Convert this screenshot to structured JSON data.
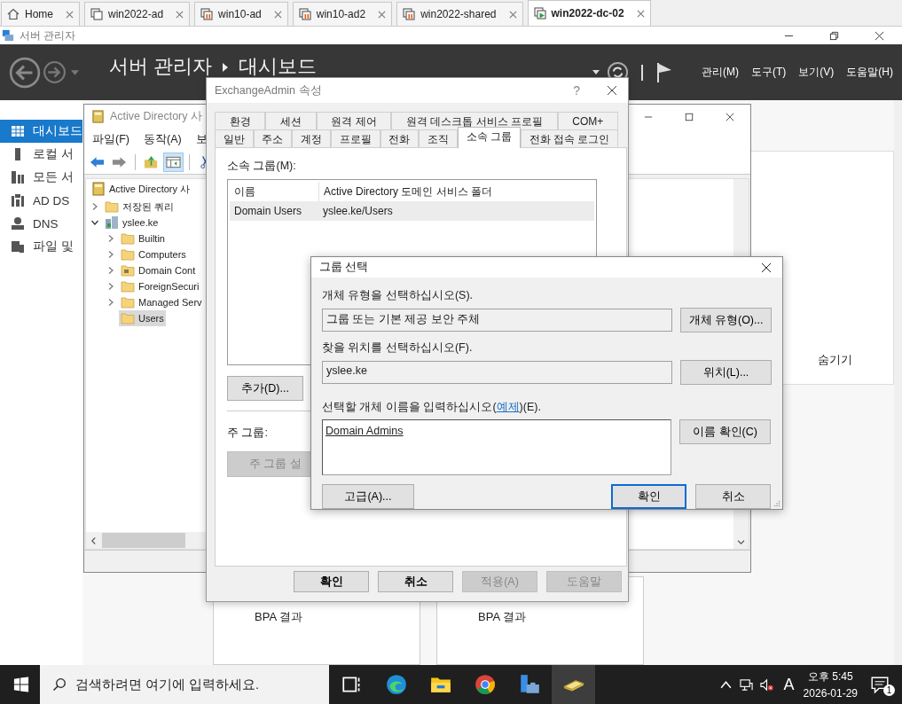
{
  "browser_tabs": [
    {
      "label": "Home",
      "kind": "home",
      "selected": false
    },
    {
      "label": "win2022-ad",
      "kind": "off",
      "selected": false
    },
    {
      "label": "win10-ad",
      "kind": "paused",
      "selected": false
    },
    {
      "label": "win10-ad2",
      "kind": "paused",
      "selected": false
    },
    {
      "label": "win2022-shared",
      "kind": "paused",
      "selected": false
    },
    {
      "label": "win2022-dc-02",
      "kind": "running",
      "selected": true
    }
  ],
  "server_manager": {
    "title": "서버 관리자",
    "breadcrumb": [
      "서버 관리자",
      "대시보드"
    ],
    "menu": [
      "관리(M)",
      "도구(T)",
      "보기(V)",
      "도움말(H)"
    ],
    "nav": [
      {
        "label": "대시보드",
        "kind": "dashboard",
        "selected": true
      },
      {
        "label": "로컬 서",
        "kind": "server",
        "selected": false
      },
      {
        "label": "모든 서",
        "kind": "servers",
        "selected": false
      },
      {
        "label": "AD DS",
        "kind": "adds",
        "selected": false
      },
      {
        "label": "DNS",
        "kind": "dns",
        "selected": false
      },
      {
        "label": "파일 및",
        "kind": "files",
        "selected": false
      }
    ],
    "side_tile": {
      "hide_link": "숨기기"
    },
    "tiles": [
      {
        "items": [
          "BPA 결과"
        ]
      },
      {
        "items": [
          "BPA 결과"
        ]
      }
    ]
  },
  "ad_window": {
    "title": "Active Directory 사",
    "menu": [
      "파일(F)",
      "동작(A)",
      "보"
    ],
    "tree_root": "Active Directory 사",
    "tree": [
      {
        "label": "저장된 쿼리",
        "kind": "folder",
        "expandable": true,
        "expanded": false,
        "selected": false
      },
      {
        "label": "yslee.ke",
        "kind": "domain",
        "expandable": true,
        "expanded": true,
        "selected": false,
        "children": [
          {
            "label": "Builtin",
            "kind": "folder",
            "expandable": true,
            "expanded": false,
            "selected": false
          },
          {
            "label": "Computers",
            "kind": "folder",
            "expandable": true,
            "expanded": false,
            "selected": false
          },
          {
            "label": "Domain Cont",
            "kind": "ou",
            "expandable": true,
            "expanded": false,
            "selected": false
          },
          {
            "label": "ForeignSecuri",
            "kind": "folder",
            "expandable": true,
            "expanded": false,
            "selected": false
          },
          {
            "label": "Managed Serv",
            "kind": "folder",
            "expandable": true,
            "expanded": false,
            "selected": false
          },
          {
            "label": "Users",
            "kind": "folder",
            "expandable": false,
            "selected": true
          }
        ]
      }
    ]
  },
  "properties": {
    "title": "ExchangeAdmin 속성",
    "help_glyph": "?",
    "tab_rows": [
      {
        "tabs": [
          {
            "label": "환경",
            "selected": false
          },
          {
            "label": "세션",
            "selected": false
          },
          {
            "label": "원격 제어",
            "selected": false
          },
          {
            "label": "원격 데스크톱 서비스 프로필",
            "selected": false
          },
          {
            "label": "COM+",
            "selected": false
          }
        ]
      },
      {
        "tabs": [
          {
            "label": "일반",
            "selected": false
          },
          {
            "label": "주소",
            "selected": false
          },
          {
            "label": "계정",
            "selected": false
          },
          {
            "label": "프로필",
            "selected": false
          },
          {
            "label": "전화",
            "selected": false
          },
          {
            "label": "조직",
            "selected": false
          },
          {
            "label": "소속 그룹",
            "selected": true
          },
          {
            "label": "전화 접속 로그인",
            "selected": false
          }
        ]
      }
    ],
    "member_of_label": "소속 그룹(M):",
    "columns": [
      "이름",
      "Active Directory 도메인 서비스 폴더"
    ],
    "rows": [
      {
        "cells": [
          "Domain Users",
          "yslee.ke/Users"
        ],
        "selected": true
      }
    ],
    "add_button": "추가(D)...",
    "primary_group_label": "주 그룹:",
    "set_primary": {
      "label": "주 그룹 설",
      "disabled": true
    },
    "buttons": [
      {
        "label": "확인",
        "disabled": false
      },
      {
        "label": "취소",
        "disabled": false
      },
      {
        "label": "적용(A)",
        "disabled": true
      },
      {
        "label": "도움말",
        "disabled": true
      }
    ]
  },
  "select_group": {
    "title": "그룹 선택",
    "object_type_label": "개체 유형을 선택하십시오(S).",
    "object_type": "그룹 또는 기본 제공 보안 주체",
    "object_type_button": "개체 유형(O)...",
    "location_label": "찾을 위치를 선택하십시오(F).",
    "location": "yslee.ke",
    "location_button": "위치(L)...",
    "names_label": {
      "before": "선택할 개체 이름을 입력하십시오(",
      "link": "예제",
      "after": ")(E)."
    },
    "names": "Domain Admins",
    "check_button": "이름 확인(C)",
    "advanced_button": "고급(A)...",
    "buttons": [
      {
        "label": "확인",
        "default": true
      },
      {
        "label": "취소",
        "default": false
      }
    ]
  },
  "taskbar": {
    "search_placeholder": "검색하려면 여기에 입력하세요.",
    "apps": [
      {
        "kind": "task-view",
        "selected": false
      },
      {
        "kind": "edge",
        "selected": false
      },
      {
        "kind": "explorer",
        "selected": false
      },
      {
        "kind": "chrome",
        "selected": false
      },
      {
        "kind": "server-manager",
        "selected": false
      },
      {
        "kind": "ad-tool",
        "selected": true
      }
    ],
    "input_indicator": "A",
    "clock": {
      "time": "오후 5:45",
      "date": "2026-01-29"
    },
    "notifications": "1"
  }
}
